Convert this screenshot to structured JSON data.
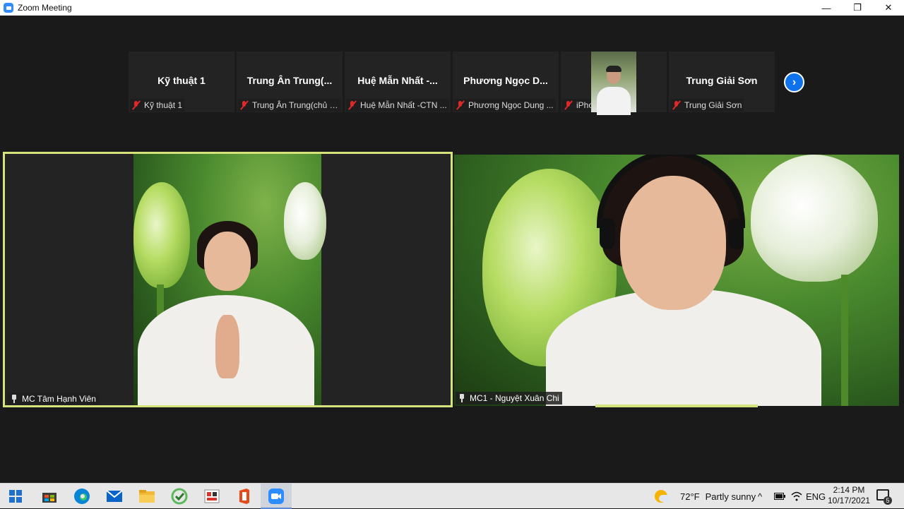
{
  "window": {
    "title": "Zoom Meeting",
    "minimize_glyph": "—",
    "restore_glyph": "❐",
    "close_glyph": "✕"
  },
  "gallery": {
    "tiles": [
      {
        "display_name": "Kỹ thuật 1",
        "label": "Kỹ thuật 1",
        "muted": true
      },
      {
        "display_name": "Trung Ân Trung(...",
        "label": "Trung Ân Trung(chủ s...",
        "muted": true
      },
      {
        "display_name": "Huệ Mẫn Nhất -...",
        "label": "Huệ Mẫn Nhất -CTN ...",
        "muted": true
      },
      {
        "display_name": "Phương Ngọc D...",
        "label": "Phương Ngọc Dung ...",
        "muted": true
      },
      {
        "display_name": "",
        "label": "iPhone",
        "muted": true,
        "video": true
      },
      {
        "display_name": "Trung Giải Sơn",
        "label": "Trung Giải Sơn",
        "muted": true
      }
    ],
    "next_glyph": "›"
  },
  "main": {
    "left_name": "MC Tâm Hạnh Viên",
    "right_name": "MC1 - Nguyệt Xuân Chi"
  },
  "taskbar": {
    "weather_temp": "72°F",
    "weather_desc": "Partly sunny",
    "language": "ENG",
    "time": "2:14 PM",
    "date": "10/17/2021",
    "notification_count": "5",
    "tray_chevron": "^"
  }
}
